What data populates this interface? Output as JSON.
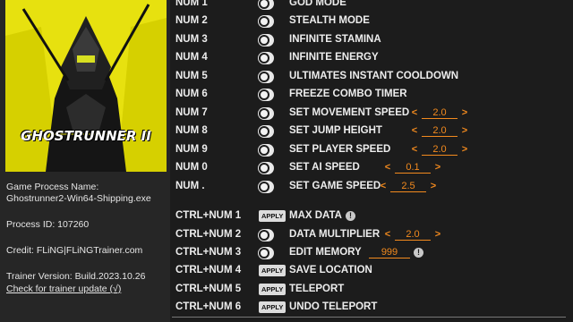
{
  "cover": {
    "logo_text": "GHOSTRUNNER II"
  },
  "process": {
    "name_label": "Game Process Name:",
    "name_value": "Ghostrunner2-Win64-Shipping.exe",
    "id_text": "Process ID: 107260",
    "credit": "Credit: FLiNG|FLiNGTrainer.com",
    "version": "Trainer Version: Build.2023.10.26",
    "update_link": "Check for trainer update (√)"
  },
  "colors": {
    "accent": "#f28a1e",
    "cover_bg": "#e7e10f"
  },
  "toggles": [
    {
      "key": "NUM 1",
      "label": "GOD MODE"
    },
    {
      "key": "NUM 2",
      "label": "STEALTH MODE"
    },
    {
      "key": "NUM 3",
      "label": "INFINITE STAMINA"
    },
    {
      "key": "NUM 4",
      "label": "INFINITE ENERGY"
    },
    {
      "key": "NUM 5",
      "label": "ULTIMATES INSTANT COOLDOWN"
    },
    {
      "key": "NUM 6",
      "label": "FREEZE COMBO TIMER"
    },
    {
      "key": "NUM 7",
      "label": "SET MOVEMENT SPEED",
      "value": "2.0"
    },
    {
      "key": "NUM 8",
      "label": "SET JUMP HEIGHT",
      "value": "2.0"
    },
    {
      "key": "NUM 9",
      "label": "SET PLAYER SPEED",
      "value": "2.0"
    },
    {
      "key": "NUM 0",
      "label": "SET AI SPEED",
      "value": "0.1"
    },
    {
      "key": "NUM .",
      "label": "SET GAME SPEED",
      "value": "2.5"
    }
  ],
  "ctrl": [
    {
      "key": "CTRL+NUM 1",
      "label": "MAX DATA",
      "apply": "APPLY"
    },
    {
      "key": "CTRL+NUM 2",
      "label": "DATA MULTIPLIER",
      "value": "2.0"
    },
    {
      "key": "CTRL+NUM 3",
      "label": "EDIT MEMORY",
      "value": "999"
    },
    {
      "key": "CTRL+NUM 4",
      "label": "SAVE LOCATION",
      "apply": "APPLY"
    },
    {
      "key": "CTRL+NUM 5",
      "label": "TELEPORT",
      "apply": "APPLY"
    },
    {
      "key": "CTRL+NUM 6",
      "label": "UNDO TELEPORT",
      "apply": "APPLY"
    }
  ],
  "spin_arrows": {
    "left": "<",
    "right": ">"
  },
  "info_glyph": "!"
}
